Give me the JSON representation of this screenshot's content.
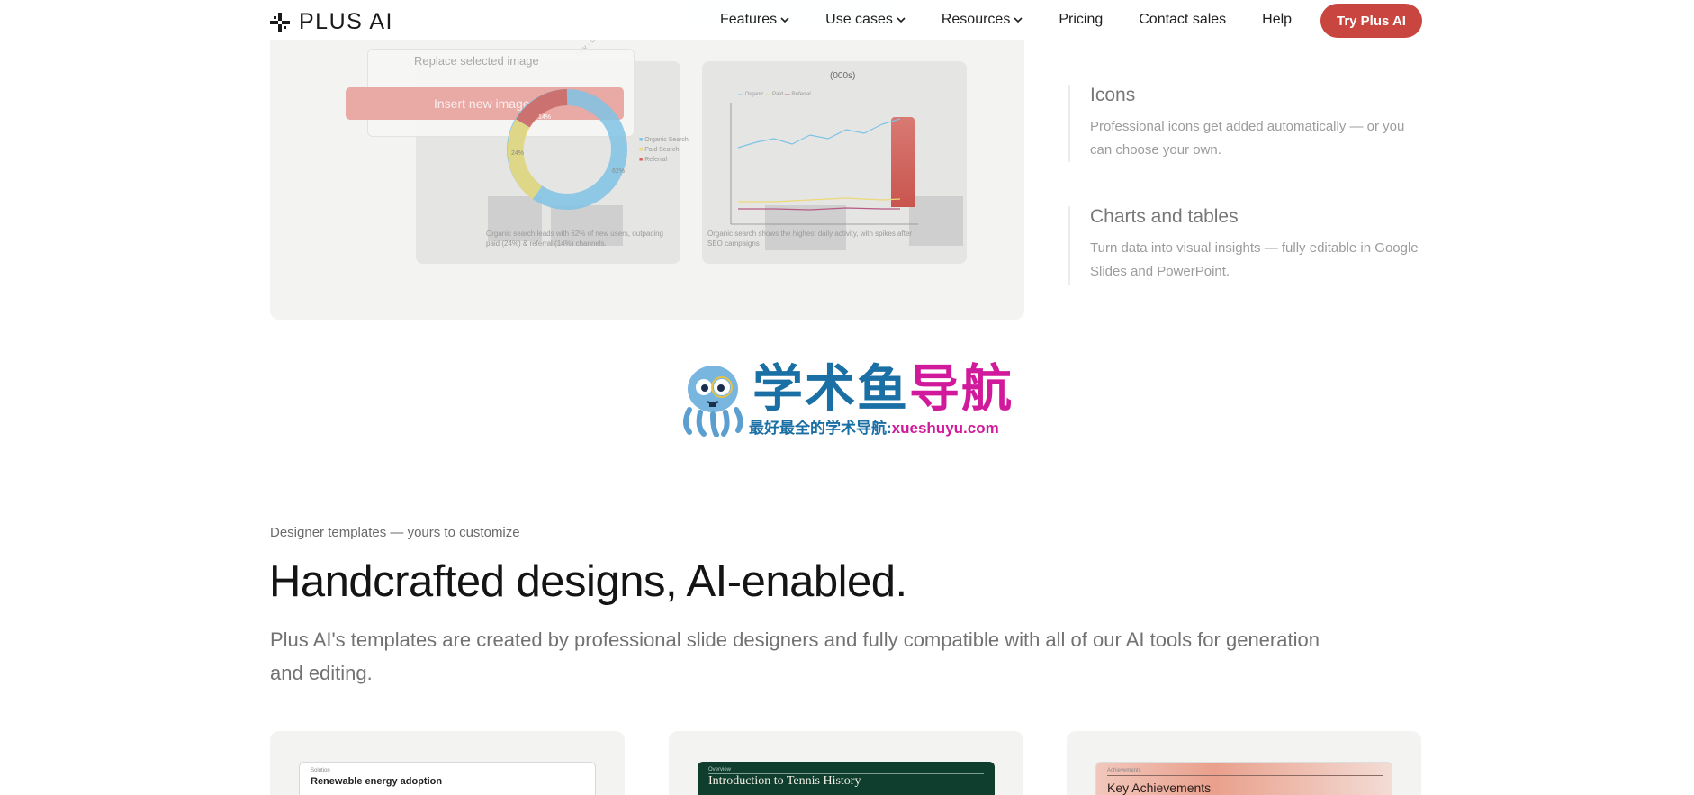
{
  "nav": {
    "brand": "PLUS AI",
    "items": [
      {
        "label": "Features",
        "has_menu": true
      },
      {
        "label": "Use cases",
        "has_menu": true
      },
      {
        "label": "Resources",
        "has_menu": true
      },
      {
        "label": "Pricing",
        "has_menu": false
      },
      {
        "label": "Contact sales",
        "has_menu": false
      },
      {
        "label": "Help",
        "has_menu": false
      }
    ],
    "cta": "Try Plus AI",
    "cta_color": "#c8463f"
  },
  "hero_image": {
    "menu_item": "Replace selected image",
    "insert_button": "Insert new image",
    "donut": {
      "labels": [
        "Organic Search",
        "Paid Search",
        "Referral"
      ],
      "percents": [
        "62%",
        "24%",
        "14%"
      ],
      "colors": [
        "#7fc3e4",
        "#ecd977",
        "#d6635c"
      ],
      "caption": "Organic search leads with 62% of new users, outpacing paid (24%) & referral (14%) channels."
    },
    "line_chart": {
      "unit": "(000s)",
      "legend": [
        "Organic",
        "Paid",
        "Referral"
      ],
      "caption": "Organic search shows the highest daily activity, with spikes after SEO campaigns"
    }
  },
  "features": [
    {
      "title": "Icons",
      "desc": "Professional icons get added automatically — or you can choose your own."
    },
    {
      "title": "Charts and tables",
      "desc": "Turn data into visual insights — fully editable in Google Slides and PowerPoint."
    }
  ],
  "watermark": {
    "title_a": "学术鱼",
    "title_b": "导航",
    "subtitle": "最好最全的学术导航:",
    "url": "xueshuyu.com"
  },
  "templates": {
    "eyebrow": "Designer templates — yours to customize",
    "headline": "Handcrafted designs, AI-enabled.",
    "lede": "Plus AI's templates are created by professional slide designers and fully compatible with all of our AI tools for generation and editing.",
    "cards": [
      {
        "kicker": "Solution",
        "title": "Renewable energy adoption"
      },
      {
        "kicker": "Overview",
        "title": "Introduction to Tennis History"
      },
      {
        "kicker": "Achievements",
        "title": "Key Achievements"
      }
    ]
  }
}
